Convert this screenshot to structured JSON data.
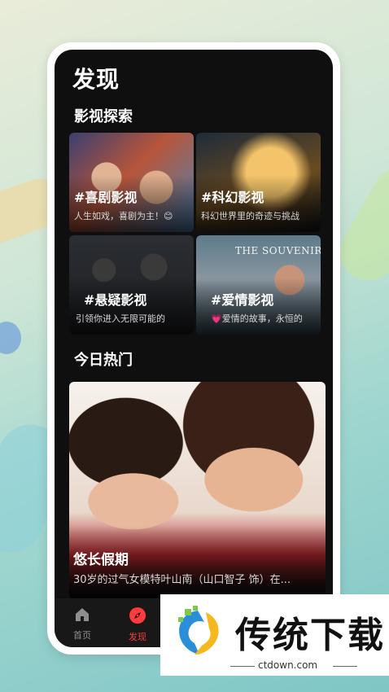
{
  "page": {
    "title": "发现"
  },
  "explore": {
    "section_title": "影视探索",
    "cards": [
      {
        "title": "#喜剧影视",
        "subtitle": "人生如戏，喜剧为主！😊"
      },
      {
        "title": "#科幻影视",
        "subtitle": "科幻世界里的奇迹与挑战"
      },
      {
        "title": "#悬疑影视",
        "subtitle": "引领你进入无限可能的"
      },
      {
        "title": "#爱情影视",
        "subtitle": "💗爱情的故事，永恒的",
        "poster_text": "THE SOUVENIR"
      }
    ]
  },
  "hot": {
    "section_title": "今日热门",
    "item": {
      "title": "悠长假期",
      "description": "30岁的过气女模特叶山南（山口智子 饰）在..."
    }
  },
  "tabbar": {
    "items": [
      {
        "label": "首页",
        "icon": "home-icon",
        "active": false
      },
      {
        "label": "发现",
        "icon": "compass-icon",
        "active": true
      }
    ],
    "active_color": "#ff3b3b",
    "inactive_color": "#8e8e8e"
  },
  "watermark": {
    "text": "传统下载",
    "url": "ctdown.com"
  }
}
